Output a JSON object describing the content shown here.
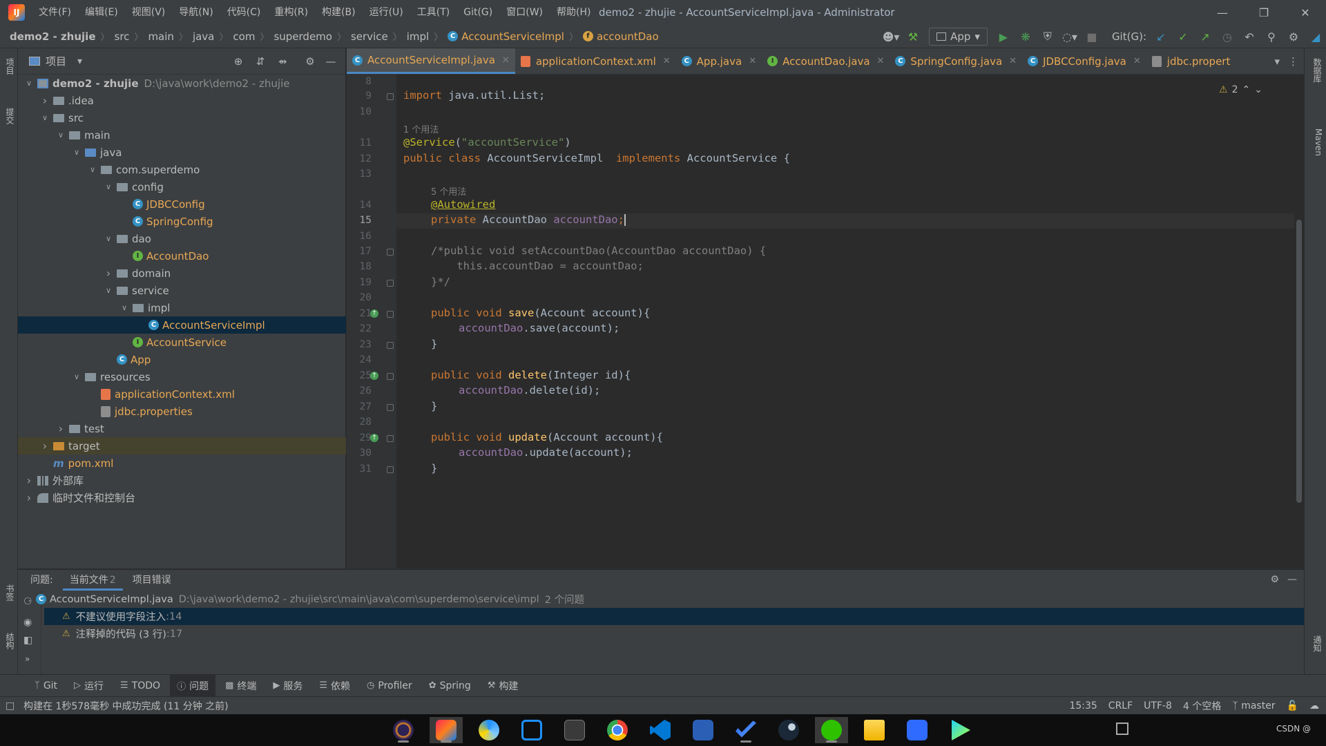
{
  "menubar": {
    "items": [
      "文件(F)",
      "编辑(E)",
      "视图(V)",
      "导航(N)",
      "代码(C)",
      "重构(R)",
      "构建(B)",
      "运行(U)",
      "工具(T)",
      "Git(G)",
      "窗口(W)",
      "帮助(H)"
    ],
    "window_title": "demo2 - zhujie - AccountServiceImpl.java - Administrator"
  },
  "breadcrumb": {
    "items": [
      "demo2 - zhujie",
      "src",
      "main",
      "java",
      "com",
      "superdemo",
      "service",
      "impl"
    ],
    "class_crumb": "AccountServiceImpl",
    "field_crumb": "accountDao"
  },
  "toolbar": {
    "run_config": "App",
    "git_label": "Git(G):"
  },
  "left_strip": {
    "project_tab": "项目",
    "commit_tab": "提交",
    "bookmarks_tab": "书签",
    "structure_tab": "结构"
  },
  "right_strip": {
    "database_tab": "数据库",
    "maven_tab": "Maven",
    "notifications_tab": "通知"
  },
  "project": {
    "title": "项目",
    "tree": [
      {
        "label": "demo2 - zhujie",
        "path": "D:\\java\\work\\demo2 - zhujie",
        "depth": 0,
        "arrow": "down",
        "icon": "module"
      },
      {
        "label": ".idea",
        "depth": 1,
        "arrow": "right",
        "icon": "folder"
      },
      {
        "label": "src",
        "depth": 1,
        "arrow": "down",
        "icon": "folder"
      },
      {
        "label": "main",
        "depth": 2,
        "arrow": "down",
        "icon": "folder"
      },
      {
        "label": "java",
        "depth": 3,
        "arrow": "down",
        "icon": "folder-blue"
      },
      {
        "label": "com.superdemo",
        "depth": 4,
        "arrow": "down",
        "icon": "package"
      },
      {
        "label": "config",
        "depth": 5,
        "arrow": "down",
        "icon": "package"
      },
      {
        "label": "JDBCConfig",
        "depth": 6,
        "icon": "class"
      },
      {
        "label": "SpringConfig",
        "depth": 6,
        "icon": "class"
      },
      {
        "label": "dao",
        "depth": 5,
        "arrow": "down",
        "icon": "package"
      },
      {
        "label": "AccountDao",
        "depth": 6,
        "icon": "interface"
      },
      {
        "label": "domain",
        "depth": 5,
        "arrow": "right",
        "icon": "package"
      },
      {
        "label": "service",
        "depth": 5,
        "arrow": "down",
        "icon": "package"
      },
      {
        "label": "impl",
        "depth": 6,
        "arrow": "down",
        "icon": "package"
      },
      {
        "label": "AccountServiceImpl",
        "depth": 7,
        "icon": "class",
        "selected": true
      },
      {
        "label": "AccountService",
        "depth": 6,
        "icon": "interface"
      },
      {
        "label": "App",
        "depth": 5,
        "icon": "class-run"
      },
      {
        "label": "resources",
        "depth": 3,
        "arrow": "down",
        "icon": "folder"
      },
      {
        "label": "applicationContext.xml",
        "depth": 4,
        "icon": "xml"
      },
      {
        "label": "jdbc.properties",
        "depth": 4,
        "icon": "properties"
      },
      {
        "label": "test",
        "depth": 2,
        "arrow": "right",
        "icon": "folder"
      },
      {
        "label": "target",
        "depth": 1,
        "arrow": "right",
        "icon": "folder-orange",
        "excluded": true
      },
      {
        "label": "pom.xml",
        "depth": 1,
        "icon": "maven"
      },
      {
        "label": "外部库",
        "depth": 0,
        "arrow": "right",
        "icon": "library"
      },
      {
        "label": "临时文件和控制台",
        "depth": 0,
        "arrow": "right",
        "icon": "scratch"
      }
    ]
  },
  "tabs": [
    {
      "label": "AccountServiceImpl.java",
      "icon": "C",
      "active": true
    },
    {
      "label": "applicationContext.xml",
      "icon": "xml"
    },
    {
      "label": "App.java",
      "icon": "C"
    },
    {
      "label": "AccountDao.java",
      "icon": "I"
    },
    {
      "label": "SpringConfig.java",
      "icon": "C"
    },
    {
      "label": "JDBCConfig.java",
      "icon": "C"
    },
    {
      "label": "jdbc.propert",
      "icon": "properties"
    }
  ],
  "editor": {
    "warning_count": "2",
    "current_line": 15,
    "usage_hint_1": "1 个用法",
    "usage_hint_2": "5 个用法",
    "line_numbers": [
      "8",
      "9",
      "10",
      "11",
      "12",
      "13",
      "14",
      "15",
      "16",
      "17",
      "18",
      "19",
      "20",
      "21",
      "22",
      "23",
      "24",
      "25",
      "26",
      "27",
      "28",
      "29",
      "30",
      "31"
    ],
    "code": {
      "l9_kw": "import",
      "l9_rest": " java.util.List;",
      "l11_ann": "@Service",
      "l11_p1": "(",
      "l11_str": "\"accountService\"",
      "l11_p2": ")",
      "l12_kw": "public class",
      "l12_name": " AccountServiceImpl  ",
      "l12_kw2": "implements",
      "l12_rest": " AccountService {",
      "l14_ann": "@Autowired",
      "l15_kw": "private",
      "l15_type": " AccountDao ",
      "l15_fld": "accountDao",
      "l15_semi": ";",
      "l17": "/*public void setAccountDao(AccountDao accountDao) {",
      "l18": "    this.accountDao = accountDao;",
      "l19": "}*/",
      "l21_kw": "public void ",
      "l21_fn": "save",
      "l21_rest": "(Account account){",
      "l22_fld": "accountDao",
      "l22_rest": ".save(account);",
      "l23": "}",
      "l25_kw": "public void ",
      "l25_fn": "delete",
      "l25_rest": "(Integer id){",
      "l26_fld": "accountDao",
      "l26_rest": ".delete(id);",
      "l27": "}",
      "l29_kw": "public void ",
      "l29_fn": "update",
      "l29_rest": "(Account account){",
      "l30_fld": "accountDao",
      "l30_rest": ".update(account);",
      "l31": "}"
    }
  },
  "problems": {
    "label": "问题:",
    "tabs": [
      {
        "label": "当前文件",
        "count": "2",
        "active": true
      },
      {
        "label": "项目错误",
        "count": ""
      }
    ],
    "file": "AccountServiceImpl.java",
    "file_path": "D:\\java\\work\\demo2 - zhujie\\src\\main\\java\\com\\superdemo\\service\\impl",
    "file_count": "2 个问题",
    "items": [
      {
        "text": "不建议使用字段注入",
        "loc": ":14"
      },
      {
        "text": "注释掉的代码 (3 行)",
        "loc": ":17"
      }
    ]
  },
  "toolwindows": [
    "Git",
    "运行",
    "TODO",
    "问题",
    "终端",
    "服务",
    "依赖",
    "Profiler",
    "Spring",
    "构建"
  ],
  "status": {
    "message": "构建在 1秒578毫秒 中成功完成 (11 分钟 之前)",
    "position": "15:35",
    "line_sep": "CRLF",
    "encoding": "UTF-8",
    "indent": "4 个空格",
    "branch": "master"
  },
  "taskbar": {
    "apps": [
      "eclipse",
      "intellij",
      "app-3",
      "app-4",
      "terminal",
      "chrome",
      "vscode",
      "app-8",
      "todo",
      "steam",
      "wechat",
      "file-explorer",
      "app-13",
      "app-14"
    ],
    "watermark": "CSDN @"
  },
  "colors": {
    "accent": "#4a88c7",
    "keyword": "#cc7832",
    "annotation": "#bbb529",
    "string": "#6a8759",
    "field": "#9876aa",
    "method": "#ffc66d"
  }
}
